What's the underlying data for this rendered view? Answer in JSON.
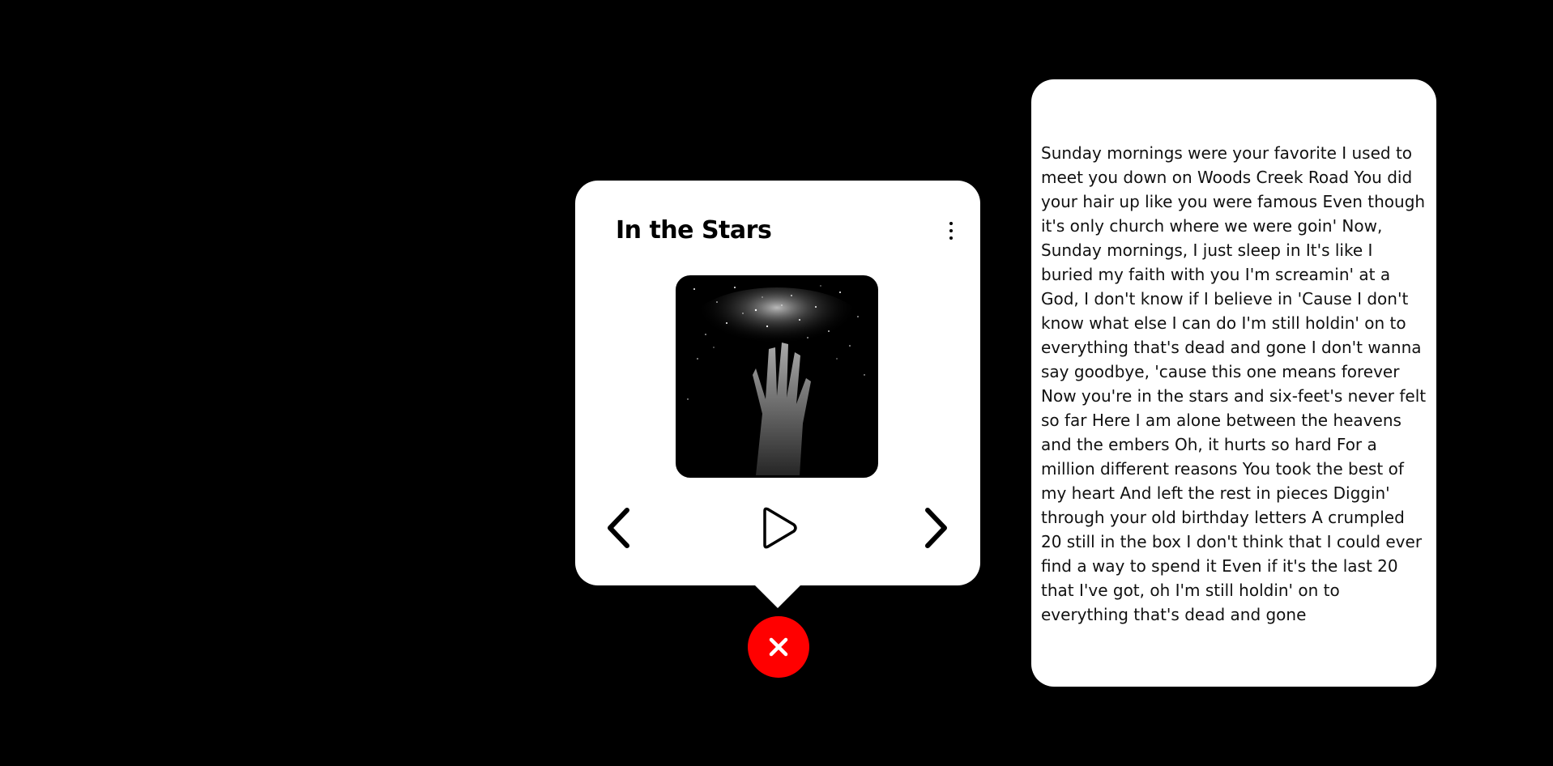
{
  "player": {
    "title": "In the Stars",
    "menu_icon": "more-vertical-icon",
    "cover_alt": "album-cover-hand-reaching-stars",
    "controls": {
      "prev_icon": "chevron-left-icon",
      "play_icon": "play-icon",
      "next_icon": "chevron-right-icon"
    }
  },
  "close": {
    "icon": "close-icon",
    "color": "#ff0000"
  },
  "lyrics": {
    "text": "Sunday mornings were your favorite I used to meet you down on Woods Creek Road You did your hair up like you were famous Even though it's only church where we were goin' Now, Sunday mornings, I just sleep in It's like I buried my faith with you I'm screamin' at a God, I don't know if I believe in 'Cause I don't know what else I can do I'm still holdin' on to everything that's dead and gone I don't wanna say goodbye, 'cause this one means forever Now you're in the stars and six-feet's never felt so far Here I am alone between the heavens and the embers Oh, it hurts so hard For a million different reasons You took the best of my heart And left the rest in pieces Diggin' through your old birthday letters A crumpled 20 still in the box I don't think that I could ever find a way to spend it Even if it's the last 20 that I've got, oh I'm still holdin' on to everything that's dead and gone"
  },
  "colors": {
    "background": "#000000",
    "card": "#ffffff",
    "accent": "#ff0000"
  }
}
